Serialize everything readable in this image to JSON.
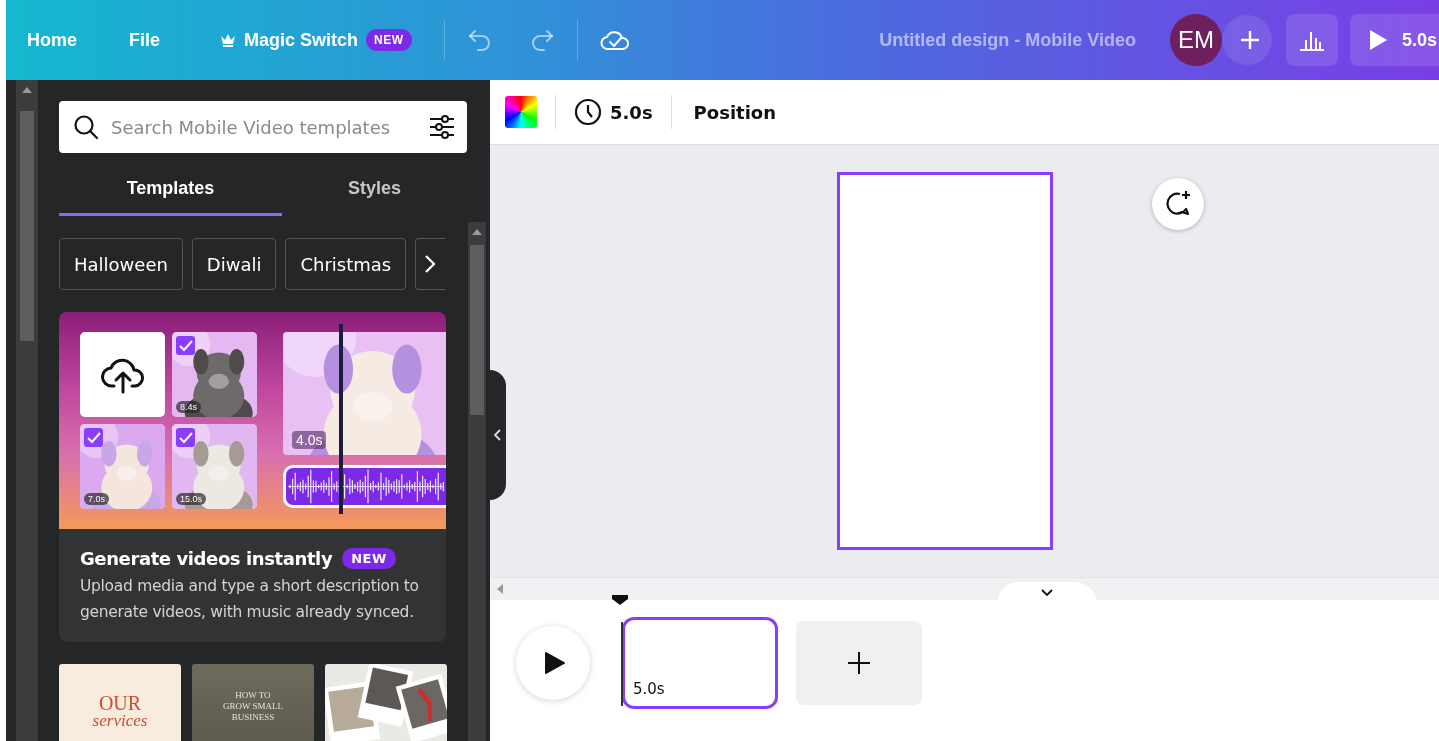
{
  "top_bar": {
    "menu": [
      {
        "label": "Home"
      },
      {
        "label": "File"
      }
    ],
    "magic_switch": {
      "label": "Magic Switch",
      "badge": "NEW"
    },
    "title": "Untitled design - Mobile Video",
    "avatar": "EM",
    "play_label": "5.0s"
  },
  "side_panel": {
    "search": {
      "placeholder": "Search Mobile Video templates"
    },
    "tabs": [
      {
        "label": "Templates",
        "selected": true
      },
      {
        "label": "Styles",
        "selected": false
      }
    ],
    "chips": [
      "Halloween",
      "Diwali",
      "Christmas"
    ],
    "feature_card": {
      "tiles": [
        {
          "kind": "upload"
        },
        {
          "checked": true,
          "duration": "8.4s"
        },
        {
          "checked": true,
          "duration": "7.0s"
        },
        {
          "checked": true,
          "duration": "15.0s"
        }
      ],
      "preview_duration": "4.0s",
      "title": "Generate videos instantly",
      "badge": "NEW",
      "description": "Upload media and type a short description to generate videos, with music already synced."
    },
    "templates": [
      {
        "kind": "services",
        "lines": [
          "OUR",
          "services"
        ]
      },
      {
        "kind": "business",
        "title": "HOW TO GROW SMALL BUSINESS"
      },
      {
        "kind": "picture"
      }
    ]
  },
  "toolbar": {
    "duration": "5.0s",
    "position": "Position"
  },
  "timeline": {
    "clips": [
      {
        "duration": "5.0s",
        "selected": true
      }
    ]
  }
}
